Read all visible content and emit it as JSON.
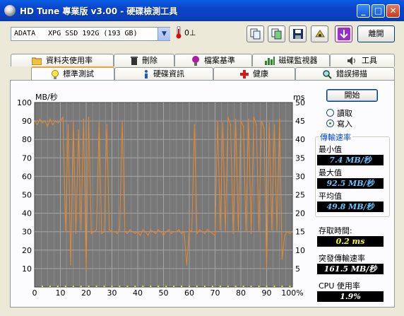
{
  "window": {
    "title": "HD Tune 專業版 v3.00 - 硬碟檢測工具",
    "minimize_icon": "minimize-icon",
    "maximize_icon": "maximize-icon",
    "close_icon": "close-icon"
  },
  "toolbar": {
    "drive": "ADATA   XPG SSD 192G (193 GB)",
    "temperature": "0⊥",
    "buttons": [
      "copy-info-icon",
      "copy-screenshot-icon",
      "save-icon",
      "options-icon",
      "down-arrow-icon"
    ],
    "exit_label": "離開"
  },
  "tabs_row1": [
    {
      "label": "資料夾使用率",
      "icon": "folder-icon"
    },
    {
      "label": "刪除",
      "icon": "trash-icon"
    },
    {
      "label": "檔案基準",
      "icon": "file-benchmark-icon"
    },
    {
      "label": "磁碟監視器",
      "icon": "disk-monitor-icon"
    },
    {
      "label": "工具",
      "icon": "speaker-icon"
    }
  ],
  "tabs_row2": [
    {
      "label": "標準測試",
      "icon": "lightbulb-icon",
      "active": true
    },
    {
      "label": "硬碟資訊",
      "icon": "info-icon"
    },
    {
      "label": "健康",
      "icon": "health-cross-icon"
    },
    {
      "label": "錯誤掃描",
      "icon": "magnifier-icon"
    }
  ],
  "controls": {
    "start_label": "開始",
    "read_label": "讀取",
    "write_label": "寫入",
    "selected_mode": "write"
  },
  "stats": {
    "transfer_rate_title": "傳輸速率",
    "min_label": "最小值",
    "min_value": "7.4 MB/秒",
    "max_label": "最大值",
    "max_value": "92.5 MB/秒",
    "avg_label": "平均值",
    "avg_value": "49.8 MB/秒",
    "access_time_label": "存取時間:",
    "access_time_value": "0.2 ms",
    "burst_label": "突發傳輸速率",
    "burst_value": "161.5 MB/秒",
    "cpu_label": "CPU 使用率",
    "cpu_value": "1.9%"
  },
  "colors": {
    "plot_background": "#787878",
    "transfer_line": "#e8882a",
    "access_points": "#e8e83a",
    "grid": "#a5a5a5",
    "min_color": "#66c6ff",
    "max_color": "#66c6ff",
    "avg_color": "#66c6ff",
    "access_color": "#ffff00",
    "burst_color": "#ffffff",
    "cpu_color": "#ffffff"
  },
  "chart_data": {
    "type": "line",
    "ylabel_left": "MB/秒",
    "ylabel_right": "ms",
    "ylim_left": [
      0,
      100
    ],
    "ylim_right": [
      0,
      50
    ],
    "yticks_left": [
      "100",
      "90",
      "80",
      "70",
      "60",
      "50",
      "40",
      "30",
      "20",
      "10"
    ],
    "yticks_right": [
      "50",
      "45",
      "40",
      "35",
      "30",
      "25",
      "20",
      "15",
      "10",
      "5"
    ],
    "xlim": [
      0,
      100
    ],
    "xticks": [
      "0",
      "10",
      "20",
      "30",
      "40",
      "50",
      "60",
      "70",
      "80",
      "90",
      "100%"
    ],
    "grid": true,
    "series": [
      {
        "kind": "transfer_rate",
        "x": [
          0,
          1,
          2,
          3,
          4,
          5,
          6,
          7,
          8,
          9,
          10,
          11,
          12,
          13,
          14,
          15,
          16,
          17,
          18,
          19,
          20,
          21,
          22,
          23,
          24,
          25,
          26,
          27,
          28,
          29,
          30,
          31,
          32,
          33,
          34,
          35,
          36,
          37,
          38,
          39,
          40,
          41,
          42,
          43,
          44,
          45,
          46,
          47,
          48,
          49,
          50,
          51,
          52,
          53,
          54,
          55,
          56,
          57,
          58,
          59,
          60,
          61,
          62,
          63,
          64,
          65,
          66,
          67,
          68,
          69,
          70,
          71,
          72,
          73,
          74,
          75,
          76,
          77,
          78,
          79,
          80,
          81,
          82,
          83,
          84,
          85,
          86,
          87,
          88,
          89,
          90,
          91,
          92,
          93,
          94,
          95,
          96,
          97,
          98,
          99,
          100
        ],
        "y": [
          90,
          88,
          91,
          89,
          90,
          87,
          91,
          88,
          90,
          89,
          90,
          92,
          30,
          88,
          12,
          90,
          29,
          85,
          31,
          91,
          9,
          92,
          29,
          30,
          31,
          90,
          29,
          30,
          88,
          31,
          30,
          30,
          29,
          31,
          90,
          30,
          29,
          31,
          30,
          29,
          30,
          28,
          31,
          30,
          28,
          31,
          30,
          29,
          31,
          30,
          28,
          30,
          31,
          29,
          30,
          30,
          31,
          29,
          30,
          12,
          31,
          30,
          88,
          29,
          31,
          30,
          29,
          31,
          30,
          29,
          28,
          90,
          31,
          89,
          30,
          92,
          88,
          29,
          91,
          30,
          90,
          87,
          30,
          91,
          29,
          92,
          88,
          30,
          90,
          86,
          10,
          89,
          31,
          88,
          30,
          91,
          15,
          28,
          30,
          29,
          30
        ]
      },
      {
        "kind": "access_time",
        "x": [
          3,
          6,
          9,
          12,
          15,
          18,
          21,
          24,
          27,
          30,
          33,
          36,
          39,
          42,
          45,
          48,
          51,
          54,
          57,
          60,
          63,
          66,
          69,
          72,
          75,
          78,
          81,
          84,
          87,
          90,
          93,
          96,
          99
        ],
        "y": [
          0.2,
          0.2,
          0.2,
          0.2,
          0.2,
          0.2,
          0.2,
          0.2,
          0.2,
          0.2,
          0.2,
          0.2,
          0.2,
          0.2,
          0.2,
          0.2,
          0.2,
          0.2,
          0.2,
          0.2,
          0.2,
          0.2,
          0.2,
          0.2,
          0.2,
          0.2,
          0.2,
          0.2,
          0.2,
          0.2,
          0.2,
          0.2,
          0.2
        ]
      }
    ]
  }
}
